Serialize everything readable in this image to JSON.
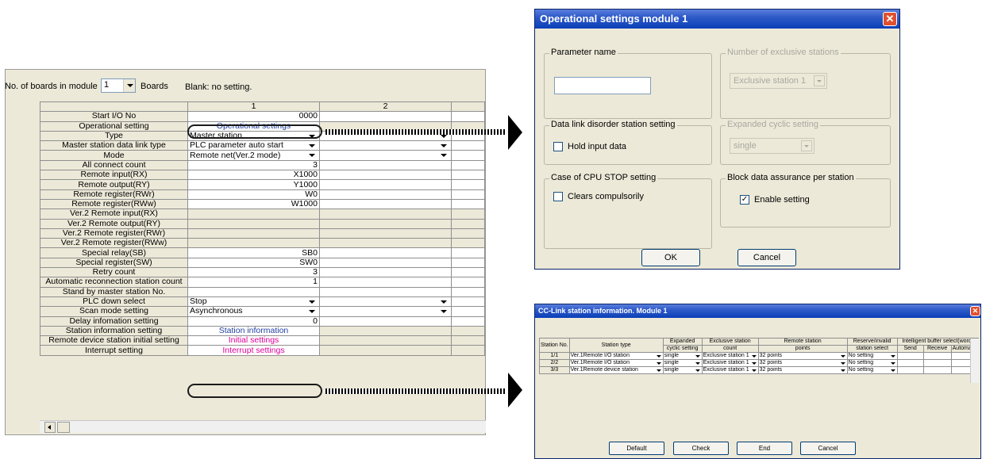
{
  "module_settings": {
    "boards_label": "No. of boards in module",
    "boards_value": "1",
    "boards_unit": "Boards",
    "blank_note": "Blank: no setting."
  },
  "param_table": {
    "columns": [
      "1",
      "2"
    ],
    "rows": [
      {
        "name": "Start I/O No",
        "value": "0000",
        "kind": "num"
      },
      {
        "name": "Operational setting",
        "value": "Operational settings",
        "kind": "link"
      },
      {
        "name": "Type",
        "value": "Master station",
        "kind": "dd"
      },
      {
        "name": "Master station data link type",
        "value": "PLC parameter auto start",
        "kind": "dd"
      },
      {
        "name": "Mode",
        "value": "Remote net(Ver.2 mode)",
        "kind": "dd"
      },
      {
        "name": "All connect count",
        "value": "3",
        "kind": "num"
      },
      {
        "name": "Remote input(RX)",
        "value": "X1000",
        "kind": "num"
      },
      {
        "name": "Remote output(RY)",
        "value": "Y1000",
        "kind": "num"
      },
      {
        "name": "Remote register(RWr)",
        "value": "W0",
        "kind": "num"
      },
      {
        "name": "Remote register(RWw)",
        "value": "W1000",
        "kind": "num"
      },
      {
        "name": "Ver.2 Remote input(RX)",
        "value": "",
        "kind": "gray"
      },
      {
        "name": "Ver.2 Remote output(RY)",
        "value": "",
        "kind": "gray"
      },
      {
        "name": "Ver.2 Remote register(RWr)",
        "value": "",
        "kind": "gray"
      },
      {
        "name": "Ver.2 Remote register(RWw)",
        "value": "",
        "kind": "gray"
      },
      {
        "name": "Special relay(SB)",
        "value": "SB0",
        "kind": "num"
      },
      {
        "name": "Special register(SW)",
        "value": "SW0",
        "kind": "num"
      },
      {
        "name": "Retry count",
        "value": "3",
        "kind": "num"
      },
      {
        "name": "Automatic reconnection station count",
        "value": "1",
        "kind": "num"
      },
      {
        "name": "Stand by master station No.",
        "value": "",
        "kind": "num"
      },
      {
        "name": "PLC down select",
        "value": "Stop",
        "kind": "dd"
      },
      {
        "name": "Scan mode setting",
        "value": "Asynchronous",
        "kind": "dd"
      },
      {
        "name": "Delay infomation setting",
        "value": "0",
        "kind": "num"
      },
      {
        "name": "Station information setting",
        "value": "Station information",
        "kind": "link"
      },
      {
        "name": "Remote device station initial setting",
        "value": "Initial settings",
        "kind": "pink"
      },
      {
        "name": "Interrupt setting",
        "value": "Interrupt settings",
        "kind": "pink"
      }
    ]
  },
  "operational_dialog": {
    "title": "Operational settings  module 1",
    "parameter_name_caption": "Parameter name",
    "parameter_name_value": "",
    "exclusive_caption": "Number of exclusive stations",
    "exclusive_value": "Exclusive station 1",
    "disorder_caption": "Data link disorder station setting",
    "hold_input_label": "Hold input data",
    "hold_input_checked": false,
    "expanded_caption": "Expanded cyclic setting",
    "expanded_value": "single",
    "cpu_stop_caption": "Case of CPU STOP setting",
    "clears_label": "Clears compulsorily",
    "clears_checked": false,
    "block_caption": "Block data assurance per station",
    "enable_label": "Enable setting",
    "enable_checked": true,
    "ok_label": "OK",
    "cancel_label": "Cancel"
  },
  "station_dialog": {
    "title": "CC-Link station information. Module 1",
    "headers": {
      "station_no": "Station No.",
      "station_type": "Station type",
      "expanded_1": "Expanded",
      "expanded_2": "cyclic setting",
      "exclusive_1": "Exclusive station",
      "exclusive_2": "count",
      "remote_1": "Remote station",
      "remote_2": "points",
      "reserve_1": "Reserve/invalid",
      "reserve_2": "station select",
      "intelligent": "Intelligent buffer select(word)",
      "send": "Send",
      "receive": "Receive",
      "automatic": "Automatic"
    },
    "rows": [
      {
        "no": "1/1",
        "type": "Ver.1Remote I/O station",
        "expanded": "single",
        "exclusive": "Exclusive station 1",
        "points": "32 points",
        "reserve": "No setting"
      },
      {
        "no": "2/2",
        "type": "Ver.1Remote I/O station",
        "expanded": "single",
        "exclusive": "Exclusive station 1",
        "points": "32 points",
        "reserve": "No setting"
      },
      {
        "no": "3/3",
        "type": "Ver.1Remote device station",
        "expanded": "single",
        "exclusive": "Exclusive station 1",
        "points": "32 points",
        "reserve": "No setting"
      }
    ],
    "buttons": {
      "default": "Default",
      "check": "Check",
      "end": "End",
      "cancel": "Cancel"
    }
  }
}
